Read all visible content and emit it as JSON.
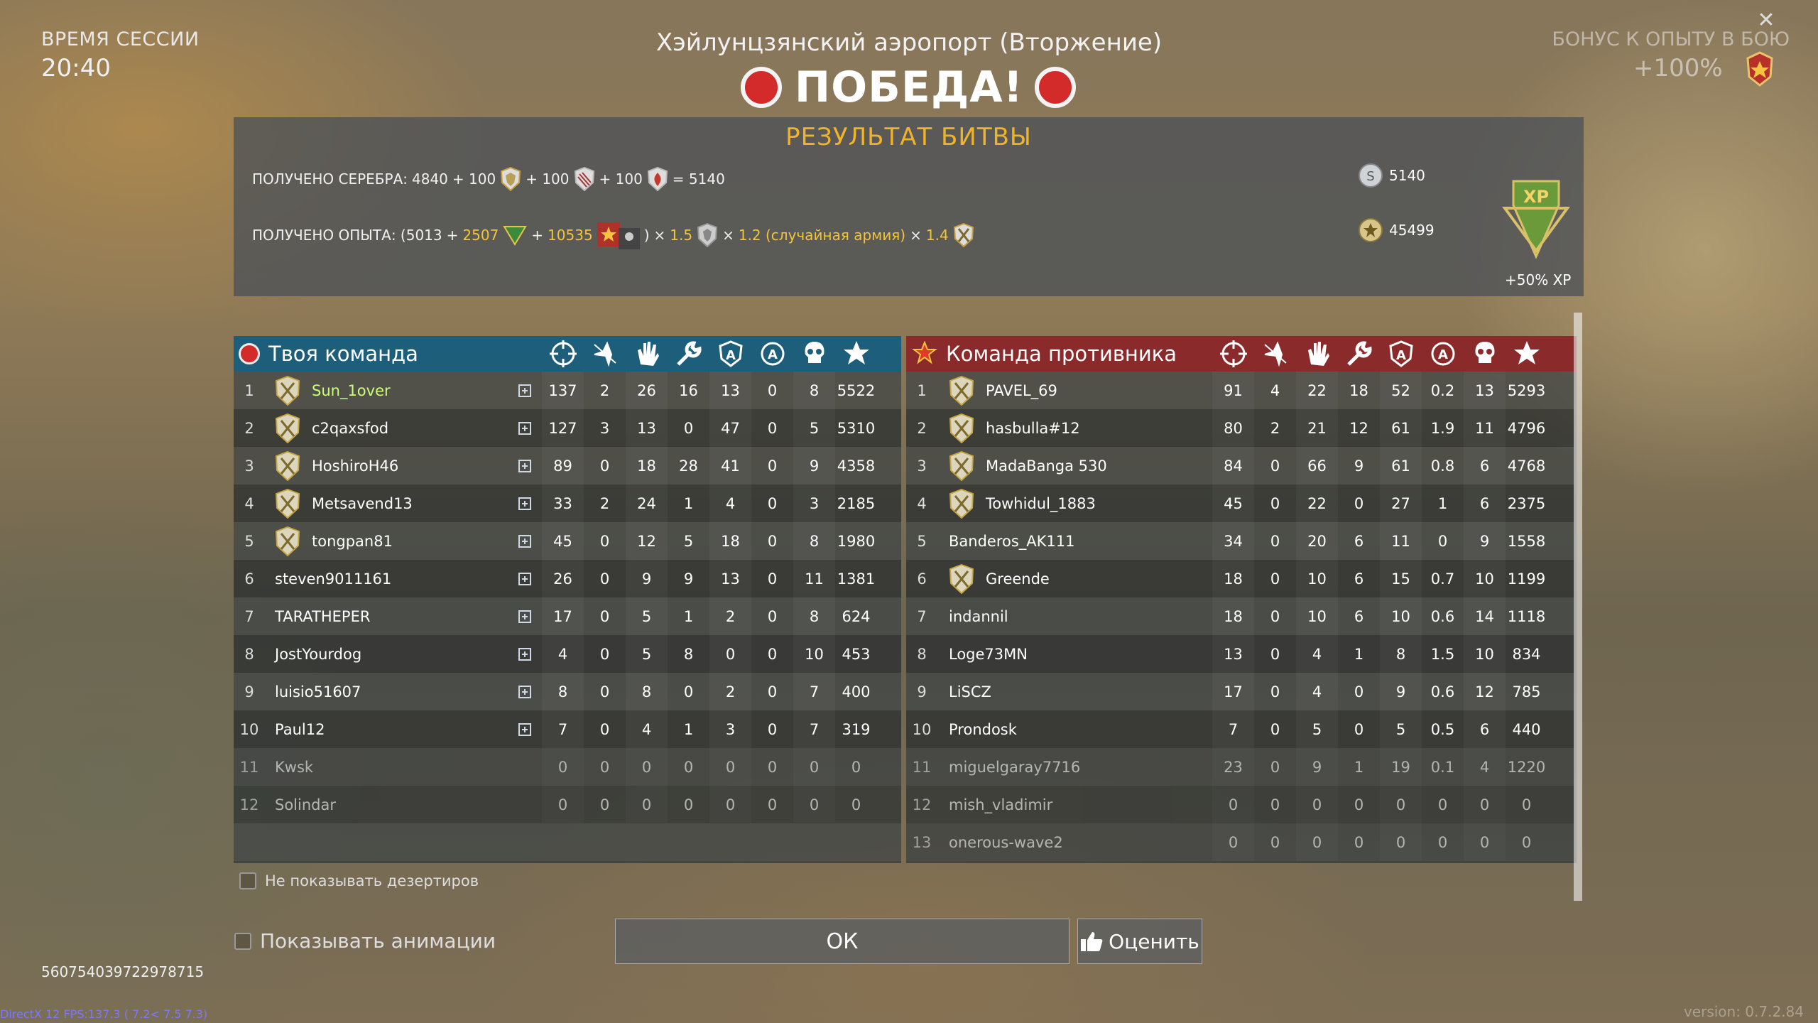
{
  "session": {
    "label": "ВРЕМЯ СЕССИИ",
    "time": "20:40"
  },
  "map_title": "Хэйлунцзянский аэропорт (Вторжение)",
  "victory": "ПОБЕДА!",
  "bonus": {
    "label": "БОНУС К ОПЫТУ В БОЮ",
    "value": "+100%"
  },
  "results": {
    "title": "РЕЗУЛЬТАТ БИТВЫ",
    "silver": {
      "prefix": "ПОЛУЧЕНО СЕРЕБРА:",
      "base": "4840",
      "add1": "+ 100",
      "add2": "+ 100",
      "add3": "+ 100",
      "total": "= 5140",
      "sum": "5140"
    },
    "xp": {
      "prefix": "ПОЛУЧЕНО ОПЫТА: (5013",
      "plus1": "+",
      "v1": "2507",
      "plus2": "+",
      "v2": "10535",
      "close": ")",
      "mul1_op": "×",
      "mul1": "1.5",
      "mul2_op": "×",
      "mul2": "1.2 (случайная армия)",
      "mul3_op": "×",
      "mul3": "1.4",
      "sum": "45499"
    },
    "xp_badge": "+50% XP"
  },
  "my_team": {
    "title": "Твоя команда",
    "rows": [
      {
        "n": "1",
        "name": "Sun_1over",
        "s": [
          "137",
          "2",
          "26",
          "16",
          "13",
          "0",
          "8",
          "5522"
        ],
        "role": "flame"
      },
      {
        "n": "2",
        "name": "c2qaxsfod",
        "s": [
          "127",
          "3",
          "13",
          "0",
          "47",
          "0",
          "5",
          "5310"
        ],
        "role": "troops"
      },
      {
        "n": "3",
        "name": "HoshiroH46",
        "s": [
          "89",
          "0",
          "18",
          "28",
          "41",
          "0",
          "9",
          "4358"
        ],
        "role": "wrench"
      },
      {
        "n": "4",
        "name": "Metsavend13",
        "s": [
          "33",
          "2",
          "24",
          "1",
          "4",
          "0",
          "3",
          "2185"
        ],
        "role": "tank"
      },
      {
        "n": "5",
        "name": "tongpan81",
        "s": [
          "45",
          "0",
          "12",
          "5",
          "18",
          "0",
          "8",
          "1980"
        ],
        "role": "list"
      },
      {
        "n": "6",
        "name": "steven9011161",
        "s": [
          "26",
          "0",
          "9",
          "9",
          "13",
          "0",
          "11",
          "1381"
        ],
        "role": "troops"
      },
      {
        "n": "7",
        "name": "TARATHEPER",
        "s": [
          "17",
          "0",
          "5",
          "1",
          "2",
          "0",
          "8",
          "624"
        ],
        "role": "bar"
      },
      {
        "n": "8",
        "name": "JostYourdog",
        "s": [
          "4",
          "0",
          "5",
          "8",
          "0",
          "0",
          "10",
          "453"
        ],
        "role": "troops"
      },
      {
        "n": "9",
        "name": "luisio51607",
        "s": [
          "8",
          "0",
          "8",
          "0",
          "2",
          "0",
          "7",
          "400"
        ],
        "role": "headset"
      },
      {
        "n": "10",
        "name": "Paul12",
        "s": [
          "7",
          "0",
          "4",
          "1",
          "3",
          "0",
          "7",
          "319"
        ],
        "role": "target"
      },
      {
        "n": "11",
        "name": "Kwsk",
        "s": [
          "0",
          "0",
          "0",
          "0",
          "0",
          "0",
          "0",
          "0"
        ],
        "role": ""
      },
      {
        "n": "12",
        "name": "Solindar",
        "s": [
          "0",
          "0",
          "0",
          "0",
          "0",
          "0",
          "0",
          "0"
        ],
        "role": ""
      }
    ]
  },
  "enemy_team": {
    "title": "Команда противника",
    "rows": [
      {
        "n": "1",
        "name": "PAVEL_69",
        "s": [
          "91",
          "4",
          "22",
          "18",
          "52",
          "0.2",
          "13",
          "5293"
        ]
      },
      {
        "n": "2",
        "name": "hasbulla#12",
        "s": [
          "80",
          "2",
          "21",
          "12",
          "61",
          "1.9",
          "11",
          "4796"
        ]
      },
      {
        "n": "3",
        "name": "MadaBanga 530",
        "s": [
          "84",
          "0",
          "66",
          "9",
          "61",
          "0.8",
          "6",
          "4768"
        ]
      },
      {
        "n": "4",
        "name": "Towhidul_1883",
        "s": [
          "45",
          "0",
          "22",
          "0",
          "27",
          "1",
          "6",
          "2375"
        ]
      },
      {
        "n": "5",
        "name": "Banderos_AK111",
        "s": [
          "34",
          "0",
          "20",
          "6",
          "11",
          "0",
          "9",
          "1558"
        ]
      },
      {
        "n": "6",
        "name": "Greende",
        "s": [
          "18",
          "0",
          "10",
          "6",
          "15",
          "0.7",
          "10",
          "1199"
        ]
      },
      {
        "n": "7",
        "name": "indannil",
        "s": [
          "18",
          "0",
          "10",
          "6",
          "10",
          "0.6",
          "14",
          "1118"
        ]
      },
      {
        "n": "8",
        "name": "Loge73MN",
        "s": [
          "13",
          "0",
          "4",
          "1",
          "8",
          "1.5",
          "10",
          "834"
        ]
      },
      {
        "n": "9",
        "name": "LiSCZ",
        "s": [
          "17",
          "0",
          "4",
          "0",
          "9",
          "0.6",
          "12",
          "785"
        ]
      },
      {
        "n": "10",
        "name": "Prondosk",
        "s": [
          "7",
          "0",
          "5",
          "0",
          "5",
          "0.5",
          "6",
          "440"
        ]
      },
      {
        "n": "11",
        "name": "miguelgaray7716",
        "s": [
          "23",
          "0",
          "9",
          "1",
          "19",
          "0.1",
          "4",
          "1220"
        ]
      },
      {
        "n": "12",
        "name": "mish_vladimir",
        "s": [
          "0",
          "0",
          "0",
          "0",
          "0",
          "0",
          "0",
          "0"
        ]
      },
      {
        "n": "13",
        "name": "onerous-wave2",
        "s": [
          "0",
          "0",
          "0",
          "0",
          "0",
          "0",
          "0",
          "0"
        ]
      }
    ]
  },
  "controls": {
    "hide_deserters": "Не показывать дезертиров",
    "show_animations": "Показывать анимации",
    "ok": "ОК",
    "rate": "Оценить"
  },
  "footer": {
    "session_id": "560754039722978715",
    "fps": "DirectX 12 FPS:137.3 ( 7.2< 7.5  7.3)",
    "version": "version: 0.7.2.84"
  },
  "colors": {
    "my_header": "#1d5e7a",
    "enemy_header": "#8a2a2a",
    "gold": "#f2c43a",
    "victory_dot": "#d32a2a"
  }
}
